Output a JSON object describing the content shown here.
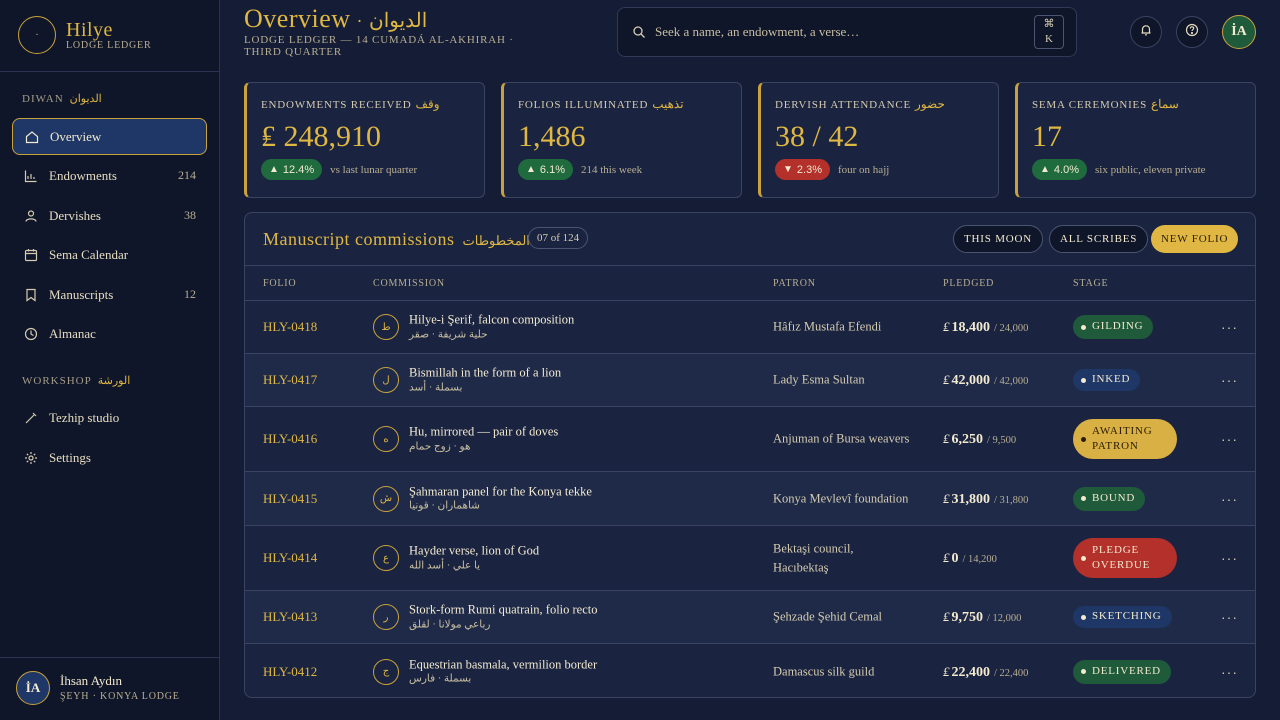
{
  "brand": {
    "name": "Hilye",
    "sub": "LODGE LEDGER",
    "mark": "·"
  },
  "sidebar": {
    "section1": {
      "label": "DIWAN",
      "ar": "الديوان"
    },
    "items": [
      {
        "label": "Overview",
        "count": ""
      },
      {
        "label": "Endowments",
        "count": "214"
      },
      {
        "label": "Dervishes",
        "count": "38"
      },
      {
        "label": "Sema Calendar",
        "count": ""
      },
      {
        "label": "Manuscripts",
        "count": "12"
      },
      {
        "label": "Almanac",
        "count": ""
      }
    ],
    "section2": {
      "label": "WORKSHOP",
      "ar": "الورشة"
    },
    "items2": [
      {
        "label": "Tezhip studio"
      },
      {
        "label": "Settings"
      }
    ]
  },
  "user": {
    "initials": "İA",
    "name": "İhsan Aydın",
    "role": "ŞEYH · KONYA LODGE"
  },
  "header": {
    "title": "Overview",
    "title_sep": "·",
    "title_ar": "الديوان",
    "subtitle": "LODGE LEDGER — 14 CUMADÁ AL-AKHIRAH · THIRD QUARTER",
    "search_placeholder": "Seek a name, an endowment, a verse…",
    "kbd_top": "⌘",
    "kbd_bottom": "K",
    "avatar": "İA"
  },
  "kpis": [
    {
      "label": "ENDOWMENTS RECEIVED",
      "ar": "وقف",
      "value": "₤ 248,910",
      "delta": "12.4%",
      "dir": "up",
      "note": "vs last lunar quarter"
    },
    {
      "label": "FOLIOS ILLUMINATED",
      "ar": "تذهيب",
      "value": "1,486",
      "delta": "6.1%",
      "dir": "up",
      "note": "214 this week"
    },
    {
      "label": "DERVISH ATTENDANCE",
      "ar": "حضور",
      "value": "38 / 42",
      "delta": "2.3%",
      "dir": "down",
      "note": "four on hajj"
    },
    {
      "label": "SEMA CEREMONIES",
      "ar": "سماع",
      "value": "17",
      "delta": "4.0%",
      "dir": "up",
      "note": "six public, eleven private"
    }
  ],
  "table": {
    "title": "Manuscript commissions",
    "title_ar": "المخطوطات",
    "count": "07 of 124",
    "btn_moon": "THIS MOON",
    "btn_scribes": "ALL SCRIBES",
    "btn_new": "NEW FOLIO",
    "columns": [
      "FOLIO",
      "COMMISSION",
      "PATRON",
      "PLEDGED",
      "STAGE"
    ],
    "currency": "₤",
    "more": "···",
    "rows": [
      {
        "id": "HLY-0418",
        "glyph": "ط",
        "title": "Hilye-i Şerif, falcon composition",
        "sub": "حلية شريفة · صقر",
        "patron": "Hâfız Mustafa Efendi",
        "amount": "18,400",
        "of": "/ 24,000",
        "stage": "GILDING",
        "tone": "green"
      },
      {
        "id": "HLY-0417",
        "glyph": "ل",
        "title": "Bismillah in the form of a lion",
        "sub": "بسملة · أسد",
        "patron": "Lady Esma Sultan",
        "amount": "42,000",
        "of": "/ 42,000",
        "stage": "INKED",
        "tone": "blue"
      },
      {
        "id": "HLY-0416",
        "glyph": "ه",
        "title": "Hu, mirrored — pair of doves",
        "sub": "هو · زوج حمام",
        "patron": "Anjuman of Bursa weavers",
        "amount": "6,250",
        "of": "/ 9,500",
        "stage": "AWAITING PATRON",
        "tone": "gold"
      },
      {
        "id": "HLY-0415",
        "glyph": "ش",
        "title": "Şahmaran panel for the Konya tekke",
        "sub": "شاهماران · قونيا",
        "patron": "Konya Mevlevî foundation",
        "amount": "31,800",
        "of": "/ 31,800",
        "stage": "BOUND",
        "tone": "green"
      },
      {
        "id": "HLY-0414",
        "glyph": "ع",
        "title": "Hayder verse, lion of God",
        "sub": "يا علي · أسد الله",
        "patron": "Bektaşi council, Hacıbektaş",
        "amount": "0",
        "of": "/ 14,200",
        "stage": "PLEDGE OVERDUE",
        "tone": "red"
      },
      {
        "id": "HLY-0413",
        "glyph": "ر",
        "title": "Stork-form Rumi quatrain, folio recto",
        "sub": "رباعي مولانا · لقلق",
        "patron": "Şehzade Şehid Cemal",
        "amount": "9,750",
        "of": "/ 12,000",
        "stage": "SKETCHING",
        "tone": "blue"
      },
      {
        "id": "HLY-0412",
        "glyph": "ج",
        "title": "Equestrian basmala, vermilion border",
        "sub": "بسملة · فارس",
        "patron": "Damascus silk guild",
        "amount": "22,400",
        "of": "/ 22,400",
        "stage": "DELIVERED",
        "tone": "green"
      }
    ]
  }
}
